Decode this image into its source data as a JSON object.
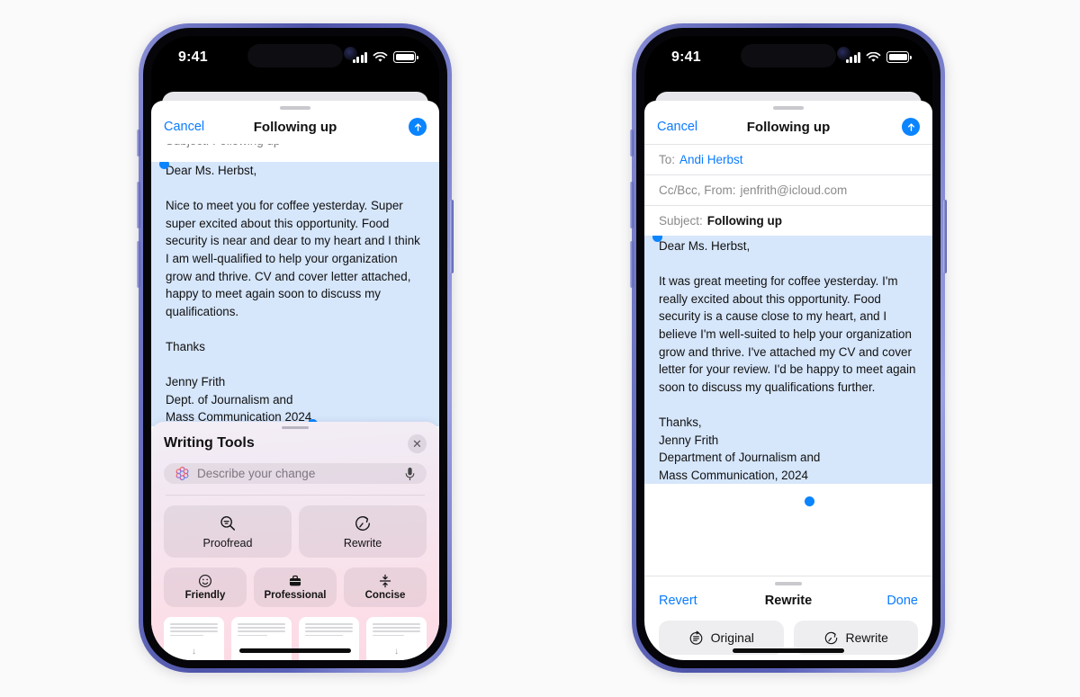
{
  "status_bar": {
    "time": "9:41",
    "cellular_icon": "signal-bars-icon",
    "wifi_icon": "wifi-icon",
    "battery_icon": "battery-icon"
  },
  "left_phone": {
    "nav": {
      "cancel_label": "Cancel",
      "title": "Following up",
      "send_icon": "send-arrow-up-icon"
    },
    "scrolled_field_hint": "Subject: Following up",
    "body_text": "Dear Ms. Herbst,\n\nNice to meet you for coffee yesterday. Super super excited about this opportunity. Food security is near and dear to my heart and I think I am well-qualified to help your organization grow and thrive. CV and cover letter attached, happy to meet again soon to discuss my qualifications.\n\nThanks\n\nJenny Frith\nDept. of Journalism and\nMass Communication 2024",
    "writing_tools": {
      "title": "Writing Tools",
      "close_icon": "close-icon",
      "ai_icon": "apple-intelligence-icon",
      "search_placeholder": "Describe your change",
      "mic_icon": "microphone-icon",
      "primary_actions": [
        {
          "label": "Proofread",
          "icon": "proofread-magnifier-icon"
        },
        {
          "label": "Rewrite",
          "icon": "rewrite-clock-arrow-icon"
        }
      ],
      "tone_actions": [
        {
          "label": "Friendly",
          "icon": "smiley-face-icon"
        },
        {
          "label": "Professional",
          "icon": "briefcase-icon"
        },
        {
          "label": "Concise",
          "icon": "compress-arrows-icon"
        }
      ],
      "summary_cards": [
        {
          "icon": "summary-down-arrow-icon"
        },
        {
          "icon": "summary-card-icon"
        },
        {
          "icon": "summary-card-icon"
        },
        {
          "icon": "summary-down-arrow-icon"
        }
      ]
    }
  },
  "right_phone": {
    "nav": {
      "cancel_label": "Cancel",
      "title": "Following up",
      "send_icon": "send-arrow-up-icon"
    },
    "fields": [
      {
        "label": "To:",
        "value": "Andi Herbst",
        "style": "link"
      },
      {
        "label": "Cc/Bcc, From:",
        "value": "jenfrith@icloud.com",
        "style": "dim"
      },
      {
        "label": "Subject:",
        "value": "Following up",
        "style": "bold"
      }
    ],
    "body_text": "Dear Ms. Herbst,\n\nIt was great meeting for coffee yesterday. I'm really excited about this opportunity. Food security is a cause close to my heart, and I believe I'm well-suited to help your organization grow and thrive. I've attached my CV and cover letter for your review. I'd be happy to meet again soon to discuss my qualifications further.\n\nThanks,\nJenny Frith\nDepartment of Journalism and\nMass Communication, 2024",
    "rewrite_bar": {
      "revert_label": "Revert",
      "title": "Rewrite",
      "done_label": "Done",
      "options": [
        {
          "label": "Original",
          "icon": "original-document-icon"
        },
        {
          "label": "Rewrite",
          "icon": "rewrite-clock-arrow-icon"
        }
      ]
    }
  },
  "colors": {
    "accent_blue": "#0a7bff",
    "selection_blue": "#d6e6fb",
    "handle_blue": "#0a84ff",
    "frame_purple": "#5a61b8",
    "panel_pink": "#fcd9e4",
    "background": "#fafafa"
  }
}
